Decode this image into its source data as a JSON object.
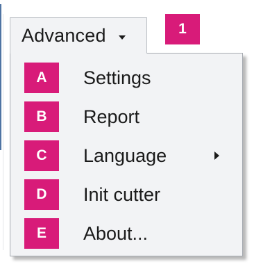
{
  "menu_button": {
    "label": "Advanced",
    "arrow_icon": "chevron-down-icon"
  },
  "callout": "1",
  "menu_items": [
    {
      "badge": "A",
      "label": "Settings"
    },
    {
      "badge": "B",
      "label": "Report"
    },
    {
      "badge": "C",
      "label": "Language",
      "submenu_icon": "triangle-right-icon"
    },
    {
      "badge": "D",
      "label": "Init cutter"
    },
    {
      "badge": "E",
      "label": "About..."
    }
  ],
  "colors": {
    "badge": "#d81b79",
    "menu_background": "#f2f3f5"
  }
}
